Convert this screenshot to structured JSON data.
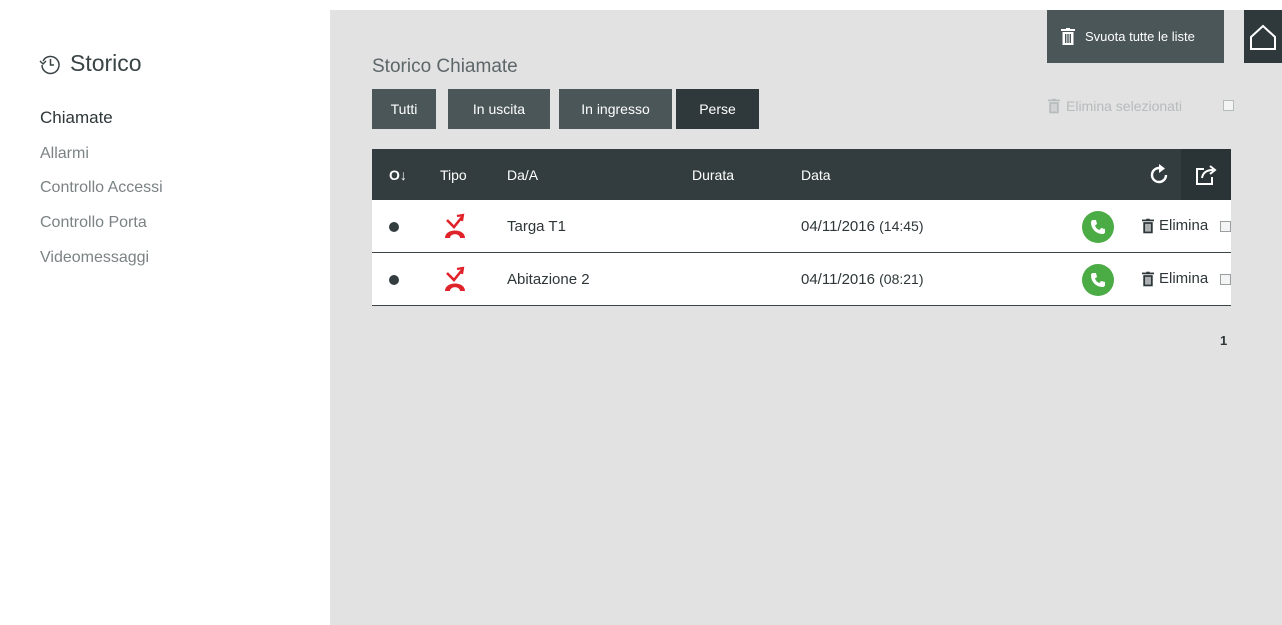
{
  "sidebar": {
    "title": "Storico",
    "items": [
      {
        "label": "Chiamate",
        "active": true
      },
      {
        "label": "Allarmi"
      },
      {
        "label": "Controllo Accessi"
      },
      {
        "label": "Controllo Porta"
      },
      {
        "label": "Videomessaggi"
      }
    ]
  },
  "main": {
    "title": "Storico Chiamate",
    "filters": [
      "Tutti",
      "In uscita",
      "In ingresso",
      "Perse"
    ],
    "active_filter": "Perse",
    "clear_all_label": "Svuota tutte le liste",
    "delete_selected_label": "Elimina selezionati"
  },
  "table": {
    "columns": {
      "status": "O↓",
      "type": "Tipo",
      "from_to": "Da/A",
      "duration": "Durata",
      "date": "Data"
    },
    "rows": [
      {
        "name": "Targa T1",
        "date": "04/11/2016",
        "time": "(14:45)",
        "duration": "",
        "type_icon": "missed-call-icon",
        "delete_label": "Elimina"
      },
      {
        "name": "Abitazione 2",
        "date": "04/11/2016",
        "time": "(08:21)",
        "duration": "",
        "type_icon": "missed-call-icon",
        "delete_label": "Elimina"
      }
    ]
  },
  "pagination": {
    "current": "1"
  },
  "colors": {
    "dark": "#333d3f",
    "button": "#4b5658",
    "missed_red": "#e0222a",
    "call_green": "#4bab45",
    "background": "#e2e2e2"
  },
  "icons": [
    "history-icon",
    "trash-icon",
    "home-icon",
    "refresh-icon",
    "export-icon",
    "missed-call-icon",
    "phone-icon"
  ]
}
